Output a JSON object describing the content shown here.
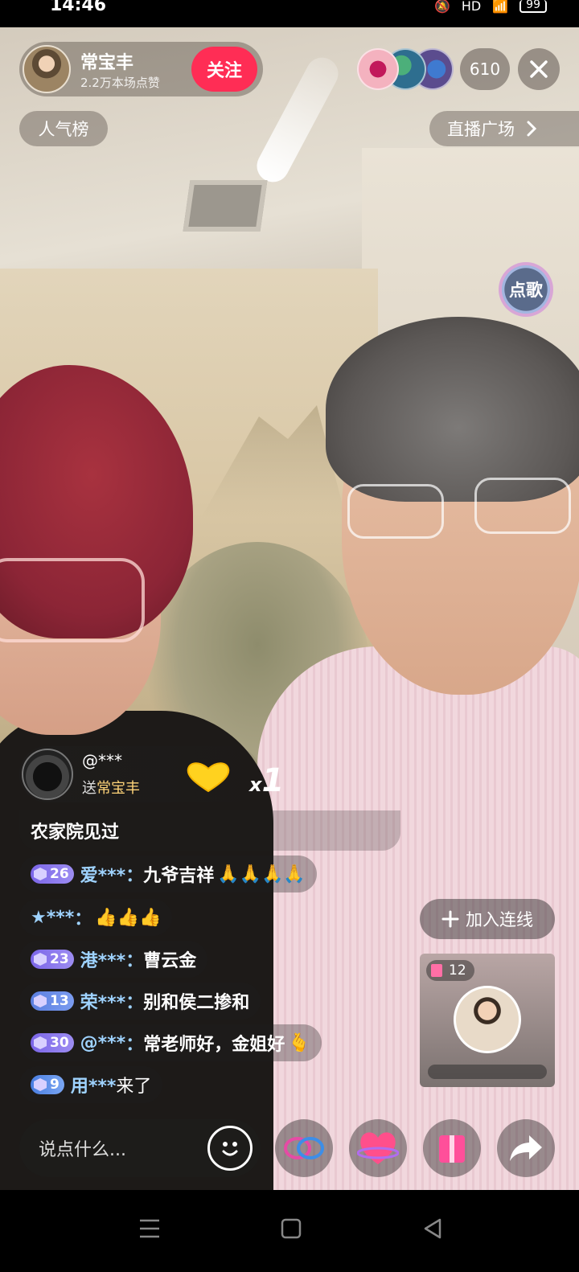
{
  "status_bar": {
    "time": "14:46",
    "battery": "99",
    "network": "HD"
  },
  "host": {
    "name": "常宝丰",
    "likes": "2.2万本场点赞",
    "follow_label": "关注"
  },
  "viewers": {
    "count": "610"
  },
  "top_actions": {
    "rank_label": "人气榜",
    "plaza_label": "直播广场"
  },
  "song_button": {
    "label": "点歌"
  },
  "gift_notice": {
    "user": "@***",
    "send_prefix": "送",
    "recipient": "常宝丰",
    "multiplier_prefix": "x",
    "multiplier_value": "1"
  },
  "comments": [
    {
      "level": "",
      "user": "",
      "separator": "",
      "text": "农家院见过"
    },
    {
      "level": "26",
      "user": "爱***",
      "separator": "：",
      "text": "九爷吉祥",
      "emoji": "🙏🙏🙏🙏"
    },
    {
      "level": "",
      "user": "★***",
      "separator": "：",
      "text": "",
      "emoji": "👍👍👍"
    },
    {
      "level": "23",
      "user": "港***",
      "separator": "：",
      "text": "曹云金"
    },
    {
      "level": "13",
      "user": "荣***",
      "separator": "：",
      "text": "别和侯二掺和"
    },
    {
      "level": "30",
      "user": "@***",
      "separator": "：",
      "text": "常老师好，金姐好",
      "emoji": "🫰"
    },
    {
      "level": "9",
      "user": "用***",
      "separator": " ",
      "text": "来了"
    }
  ],
  "join_link": {
    "label": "加入连线"
  },
  "mini_player": {
    "count": "12"
  },
  "bottom_bar": {
    "input_placeholder": "说点什么..."
  },
  "icons": [
    "close-icon",
    "chevron-right-icon",
    "plus-icon",
    "emoji-icon",
    "link-icon",
    "heart-icon",
    "gift-icon",
    "share-icon",
    "menu-icon",
    "home-icon",
    "back-icon"
  ],
  "colors": {
    "follow": "#ff2d55",
    "username": "#9fd3ff",
    "recipient": "#ffd479",
    "badge": "#7b66e8"
  }
}
